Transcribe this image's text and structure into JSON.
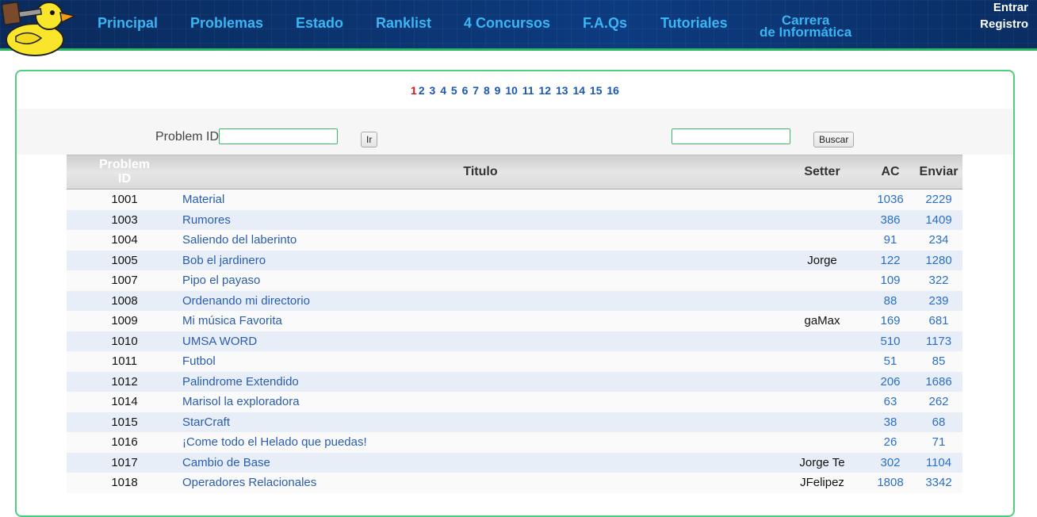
{
  "header": {
    "nav": [
      {
        "label": "Principal"
      },
      {
        "label": "Problemas"
      },
      {
        "label": "Estado"
      },
      {
        "label": "Ranklist"
      },
      {
        "label": "4 Concursos"
      },
      {
        "label": "F.A.Qs"
      },
      {
        "label": "Tutoriales"
      }
    ],
    "carrera_line1": "Carrera",
    "carrera_line2": "de Informática",
    "login": "Entrar",
    "register": "Registro"
  },
  "pager": {
    "current": "1",
    "pages": [
      "2",
      "3",
      "4",
      "5",
      "6",
      "7",
      "8",
      "9",
      "10",
      "11",
      "12",
      "13",
      "14",
      "15",
      "16"
    ]
  },
  "search": {
    "pid_label": "Problem ID",
    "go_button": "Ir",
    "search_button": "Buscar"
  },
  "table": {
    "headers": {
      "pid_line1": "Problem",
      "pid_line2": "ID",
      "title": "Titulo",
      "setter": "Setter",
      "ac": "AC",
      "submit": "Enviar"
    },
    "rows": [
      {
        "id": "1001",
        "title": "Material",
        "setter": "",
        "ac": "1036",
        "submit": "2229"
      },
      {
        "id": "1003",
        "title": "Rumores",
        "setter": "",
        "ac": "386",
        "submit": "1409"
      },
      {
        "id": "1004",
        "title": "Saliendo del laberinto",
        "setter": "",
        "ac": "91",
        "submit": "234"
      },
      {
        "id": "1005",
        "title": "Bob el jardinero",
        "setter": "Jorge",
        "ac": "122",
        "submit": "1280"
      },
      {
        "id": "1007",
        "title": "Pipo el payaso",
        "setter": "",
        "ac": "109",
        "submit": "322"
      },
      {
        "id": "1008",
        "title": "Ordenando mi directorio",
        "setter": "",
        "ac": "88",
        "submit": "239"
      },
      {
        "id": "1009",
        "title": "Mi música Favorita",
        "setter": "gaMax",
        "ac": "169",
        "submit": "681"
      },
      {
        "id": "1010",
        "title": "UMSA WORD",
        "setter": "",
        "ac": "510",
        "submit": "1173"
      },
      {
        "id": "1011",
        "title": "Futbol",
        "setter": "",
        "ac": "51",
        "submit": "85"
      },
      {
        "id": "1012",
        "title": "Palindrome Extendido",
        "setter": "",
        "ac": "206",
        "submit": "1686"
      },
      {
        "id": "1014",
        "title": "Marisol la exploradora",
        "setter": "",
        "ac": "63",
        "submit": "262"
      },
      {
        "id": "1015",
        "title": "StarCraft",
        "setter": "",
        "ac": "38",
        "submit": "68"
      },
      {
        "id": "1016",
        "title": "¡Come todo el Helado que puedas!",
        "setter": "",
        "ac": "26",
        "submit": "71"
      },
      {
        "id": "1017",
        "title": "Cambio de Base",
        "setter": "Jorge Te",
        "ac": "302",
        "submit": "1104"
      },
      {
        "id": "1018",
        "title": "Operadores Relacionales",
        "setter": "JFelipez",
        "ac": "1808",
        "submit": "3342"
      }
    ]
  },
  "colors": {
    "header_bg": "#0b3470",
    "nav_link": "#39b6f3",
    "accent_green": "#29b960",
    "link_blue": "#2a5db0",
    "pager_current": "#e01010"
  },
  "icons": {
    "logo": "duck-with-hammer-logo"
  }
}
